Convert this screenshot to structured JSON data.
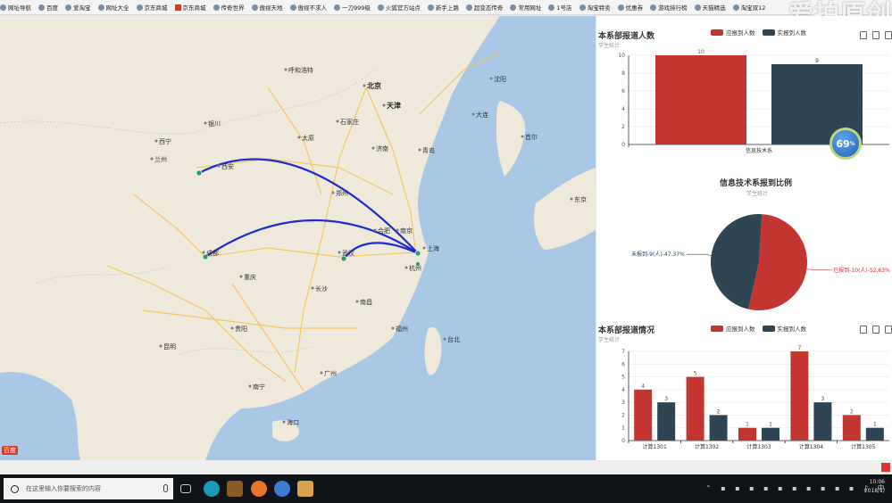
{
  "bookmarks": [
    {
      "label": "网址导航"
    },
    {
      "label": "百度"
    },
    {
      "label": "爱淘宝"
    },
    {
      "label": "网址大全"
    },
    {
      "label": "京东商城"
    },
    {
      "label": "京东商城",
      "icon": "red"
    },
    {
      "label": "传奇世界"
    },
    {
      "label": "傲视天地"
    },
    {
      "label": "傲视不求人"
    },
    {
      "label": "一刀999级"
    },
    {
      "label": "火狐官方站点"
    },
    {
      "label": "新手上路"
    },
    {
      "label": "超变态传奇"
    },
    {
      "label": "常用网址"
    },
    {
      "label": "1号店"
    },
    {
      "label": "淘宝特卖"
    },
    {
      "label": "优惠券"
    },
    {
      "label": "游戏排行榜"
    },
    {
      "label": "天猫精选"
    },
    {
      "label": "淘宝双12"
    }
  ],
  "watermark": "爱拍原创",
  "map": {
    "cities": [
      "北京",
      "天津",
      "石家庄",
      "太原",
      "呼和浩特",
      "济南",
      "青岛",
      "郑州",
      "西安",
      "兰州",
      "西宁",
      "银川",
      "成都",
      "重庆",
      "武汉",
      "长沙",
      "南京",
      "上海",
      "杭州",
      "合肥",
      "南昌",
      "福州",
      "广州",
      "南宁",
      "贵阳",
      "昆明",
      "海口",
      "台北",
      "沈阳",
      "大连",
      "首尔",
      "东京"
    ],
    "logo_text": "百度"
  },
  "chart1": {
    "title": "本系部报道人数",
    "subtitle": "学生统计",
    "legend": [
      "应报到人数",
      "实报到人数"
    ],
    "colors": [
      "#c23531",
      "#2f4554"
    ],
    "chart_data": {
      "type": "bar",
      "categories": [
        "信息技术系"
      ],
      "series": [
        {
          "name": "应报到人数",
          "values": [
            10
          ]
        },
        {
          "name": "实报到人数",
          "values": [
            9
          ]
        }
      ],
      "ylim": [
        0,
        10
      ],
      "yticks": [
        0,
        2,
        4,
        6,
        8,
        10
      ]
    }
  },
  "badge": "69",
  "chart2": {
    "title": "信息技术系报到比例",
    "subtitle": "学生统计",
    "chart_data": {
      "type": "pie",
      "slices": [
        {
          "label": "已报到-10(人)-52.63%",
          "value": 52.63,
          "color": "#c23531"
        },
        {
          "label": "未报到-9(人)-47.37%",
          "value": 47.37,
          "color": "#2f4554"
        }
      ]
    }
  },
  "chart3": {
    "title": "本系部报道情况",
    "subtitle": "学生统计",
    "legend": [
      "应报到人数",
      "实报到人数"
    ],
    "colors": [
      "#c23531",
      "#2f4554"
    ],
    "chart_data": {
      "type": "bar",
      "categories": [
        "计算1301",
        "计算1302",
        "计算1303",
        "计算1304",
        "计算1305"
      ],
      "series": [
        {
          "name": "应报到人数",
          "values": [
            4,
            5,
            1,
            7,
            2
          ]
        },
        {
          "name": "实报到人数",
          "values": [
            3,
            2,
            1,
            3,
            1
          ]
        }
      ],
      "ylim": [
        0,
        7
      ],
      "yticks": [
        0,
        1,
        2,
        3,
        4,
        5,
        6,
        7
      ]
    }
  },
  "taskbar": {
    "search_placeholder": "在这里输入你要搜索的内容",
    "time": "10:06",
    "date": "2018/1/",
    "ime": "中"
  }
}
